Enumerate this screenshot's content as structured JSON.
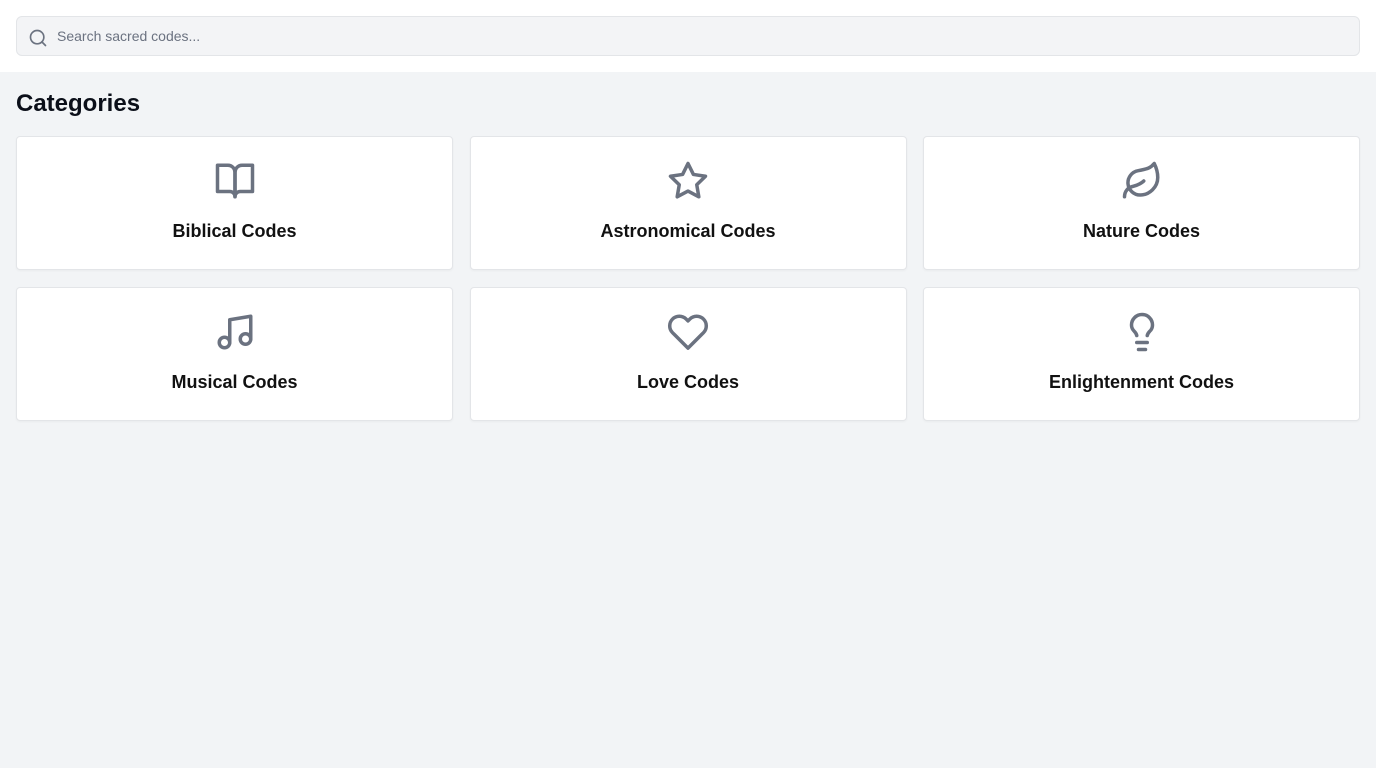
{
  "search": {
    "placeholder": "Search sacred codes..."
  },
  "main": {
    "title": "Categories",
    "categories": [
      {
        "label": "Biblical Codes",
        "icon": "book-open-icon"
      },
      {
        "label": "Astronomical Codes",
        "icon": "star-icon"
      },
      {
        "label": "Nature Codes",
        "icon": "leaf-icon"
      },
      {
        "label": "Musical Codes",
        "icon": "music-note-icon"
      },
      {
        "label": "Love Codes",
        "icon": "heart-icon"
      },
      {
        "label": "Enlightenment Codes",
        "icon": "lightbulb-icon"
      }
    ]
  },
  "colors": {
    "background": "#f2f4f6",
    "card": "#ffffff",
    "icon": "#6b7280",
    "text": "#111111"
  }
}
